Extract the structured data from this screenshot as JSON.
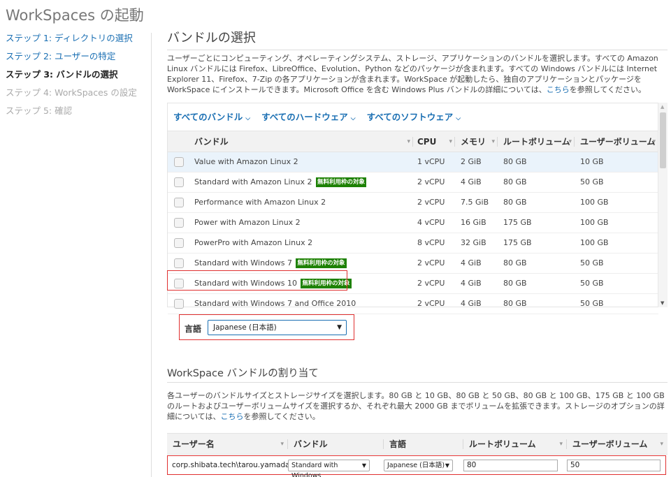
{
  "page": {
    "title": "WorkSpaces の起動"
  },
  "steps": [
    {
      "label": "ステップ 1: ディレクトリの選択"
    },
    {
      "label": "ステップ 2: ユーザーの特定"
    },
    {
      "label": "ステップ 3: バンドルの選択"
    },
    {
      "label": "ステップ 4: WorkSpaces の設定"
    },
    {
      "label": "ステップ 5: 確認"
    }
  ],
  "bundle_section": {
    "title": "バンドルの選択",
    "desc_before_link": "ユーザーごとにコンピューティング、オペレーティングシステム、ストレージ、アプリケーションのバンドルを選択します。すべての Amazon Linux バンドルには Firefox、LibreOffice、Evolution、Python などのパッケージが含まれます。すべての Windows バンドルには Internet Explorer 11、Firefox、7-Zip の各アプリケーションが含まれます。WorkSpace が起動したら、独自のアプリケーションとパッケージを WorkSpace にインストールできます。Microsoft Office を含む Windows Plus バンドルの詳細については、",
    "desc_link": "こちら",
    "desc_after_link": "を参照してください。",
    "filters": [
      "すべてのバンドル",
      "すべてのハードウェア",
      "すべてのソフトウェア"
    ],
    "columns": [
      "バンドル",
      "CPU",
      "メモリ",
      "ルートボリューム",
      "ユーザーボリューム"
    ],
    "free_badge": "無料利用枠の対象",
    "rows": [
      {
        "bundle": "Value with Amazon Linux 2",
        "cpu": "1 vCPU",
        "memory": "2 GiB",
        "root": "80 GB",
        "user": "10 GB",
        "free": false
      },
      {
        "bundle": "Standard with Amazon Linux 2",
        "cpu": "2 vCPU",
        "memory": "4 GiB",
        "root": "80 GB",
        "user": "50 GB",
        "free": true
      },
      {
        "bundle": "Performance with Amazon Linux 2",
        "cpu": "2 vCPU",
        "memory": "7.5 GiB",
        "root": "80 GB",
        "user": "100 GB",
        "free": false
      },
      {
        "bundle": "Power with Amazon Linux 2",
        "cpu": "4 vCPU",
        "memory": "16 GiB",
        "root": "175 GB",
        "user": "100 GB",
        "free": false
      },
      {
        "bundle": "PowerPro with Amazon Linux 2",
        "cpu": "8 vCPU",
        "memory": "32 GiB",
        "root": "175 GB",
        "user": "100 GB",
        "free": false
      },
      {
        "bundle": "Standard with Windows 7",
        "cpu": "2 vCPU",
        "memory": "4 GiB",
        "root": "80 GB",
        "user": "50 GB",
        "free": true
      },
      {
        "bundle": "Standard with Windows 10",
        "cpu": "2 vCPU",
        "memory": "4 GiB",
        "root": "80 GB",
        "user": "50 GB",
        "free": true
      },
      {
        "bundle": "Standard with Windows 7 and Office 2010",
        "cpu": "2 vCPU",
        "memory": "4 GiB",
        "root": "80 GB",
        "user": "50 GB",
        "free": false
      }
    ],
    "language_label": "言語",
    "language_value": "Japanese (日本語)"
  },
  "assign_section": {
    "title": "WorkSpace バンドルの割り当て",
    "desc_before_link": "各ユーザーのバンドルサイズとストレージサイズを選択します。80 GB と 10 GB、80 GB と 50 GB、80 GB と 100 GB、175 GB と 100 GB のルートおよびユーザーボリュームサイズを選択するか、それぞれ最大 2000 GB までボリュームを拡張できます。ストレージのオプションの詳細については、",
    "desc_link": "こちら",
    "desc_after_link": "を参照してください。",
    "columns": [
      "ユーザー名",
      "バンドル",
      "言語",
      "ルートボリューム",
      "ユーザーボリューム"
    ],
    "row": {
      "username": "corp.shibata.tech\\tarou.yamada",
      "bundle": "Standard with Windows",
      "language": "Japanese (日本語)",
      "root": "80",
      "user": "50"
    }
  },
  "icons": {
    "chevron": "chevron-down-icon",
    "sort": "sort-icon",
    "dropdown": "triangle-down-icon"
  }
}
